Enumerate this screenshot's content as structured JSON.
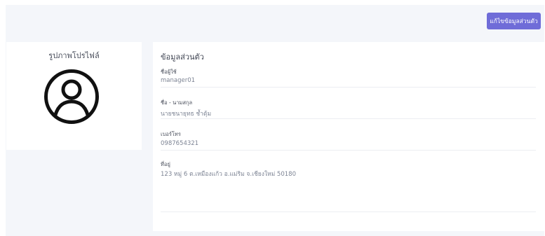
{
  "header": {
    "edit_button_label": "แก้ไขข้อมูลส่วนตัว"
  },
  "profile_card": {
    "title": "รูปภาพโปรไฟล์",
    "avatar_icon": "user-circle-icon"
  },
  "info": {
    "title": "ข้อมูลส่วนตัว",
    "fields": [
      {
        "label": "ชื่อผู้ใช้",
        "value": "manager01"
      },
      {
        "label": "ชื่อ - นามสกุล",
        "value": "นายชนายุทธ ช้ำตุ้ม"
      },
      {
        "label": "เบอร์โทร",
        "value": "0987654321"
      },
      {
        "label": "ที่อยู่",
        "value": "123 หมู่ 6 ต.เหมืองแก้ว อ.แม่ริม จ.เชียงใหม่ 50180"
      }
    ]
  },
  "colors": {
    "accent": "#6f6cd8",
    "page_background": "#f4f6fa",
    "card_background": "#ffffff"
  }
}
